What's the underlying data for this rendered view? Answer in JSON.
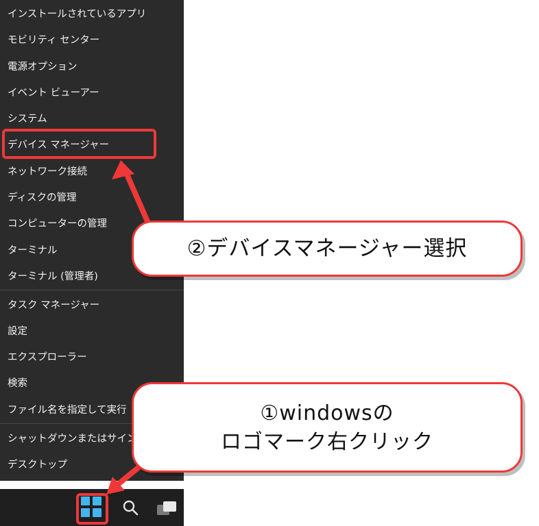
{
  "menu": {
    "items": [
      {
        "label": "インストールされているアプリ"
      },
      {
        "label": "モビリティ センター"
      },
      {
        "label": "電源オプション"
      },
      {
        "label": "イベント ビューアー"
      },
      {
        "label": "システム"
      },
      {
        "label": "デバイス マネージャー"
      },
      {
        "label": "ネットワーク接続"
      },
      {
        "label": "ディスクの管理"
      },
      {
        "label": "コンピューターの管理"
      },
      {
        "label": "ターミナル"
      },
      {
        "label": "ターミナル (管理者)"
      },
      {
        "label": "タスク マネージャー"
      },
      {
        "label": "設定"
      },
      {
        "label": "エクスプローラー"
      },
      {
        "label": "検索"
      },
      {
        "label": "ファイル名を指定して実行"
      },
      {
        "label": "シャットダウンまたはサインアウト"
      },
      {
        "label": "デスクトップ"
      }
    ]
  },
  "taskbar": {
    "icons": [
      "windows-start-icon",
      "search-icon",
      "task-view-icon"
    ]
  },
  "callouts": {
    "step2": "②デバイスマネージャー選択",
    "step1_line1": "①windowsの",
    "step1_line2": "ロゴマーク右クリック"
  },
  "colors": {
    "menu_bg": "#2b2b2b",
    "highlight": "#ef3838",
    "windows_logo": "#46b4ef"
  }
}
